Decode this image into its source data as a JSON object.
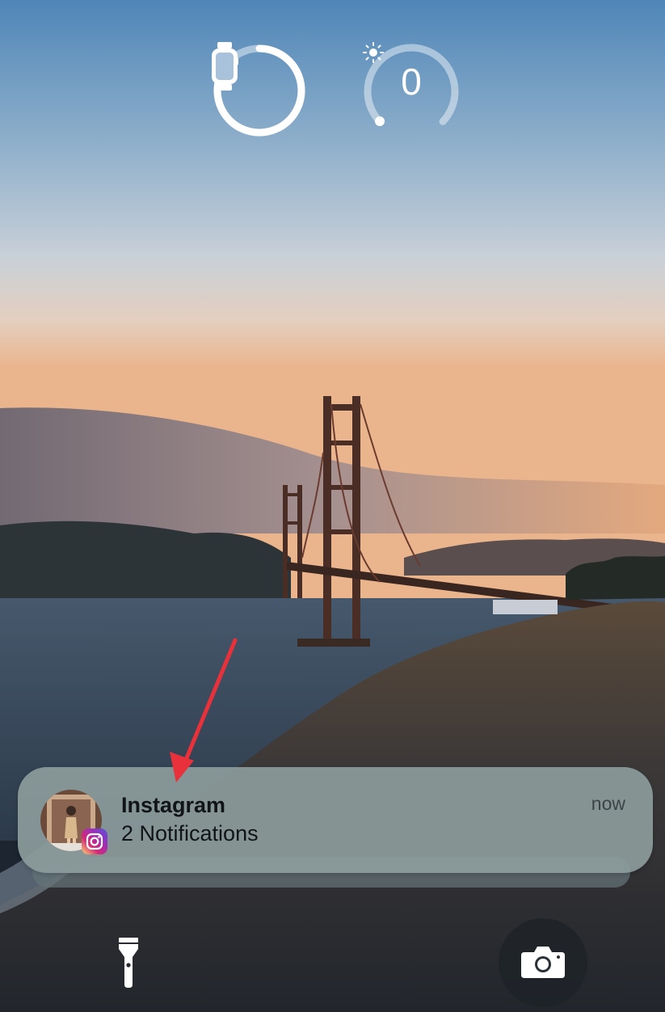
{
  "widgets": {
    "battery": {
      "icon": "apple-watch-icon",
      "level": 0.78
    },
    "uv_index": {
      "value": "0",
      "icon": "sun-icon",
      "gauge_level": 0.02
    }
  },
  "notification": {
    "app_name": "Instagram",
    "summary": "2 Notifications",
    "time": "now",
    "app_icon": "instagram-icon"
  },
  "bottom_controls": {
    "flashlight_icon": "flashlight-icon",
    "camera_icon": "camera-icon"
  },
  "colors": {
    "annotation_arrow": "#e8313a",
    "instagram_gradient": [
      "#feda75",
      "#d62976",
      "#962fbf",
      "#4f5bd5"
    ]
  }
}
